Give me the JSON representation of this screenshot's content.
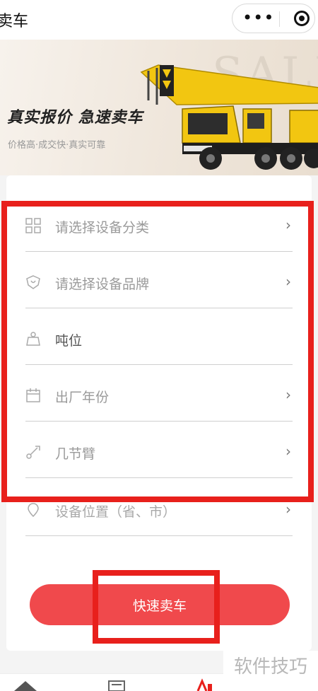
{
  "header": {
    "title": "卖车",
    "more_icon": "ellipsis-icon",
    "close_icon": "target-icon"
  },
  "banner": {
    "bg_text": "SALE",
    "headline": "真实报价  急速卖车",
    "subtitle": "价格高·成交快·真实可靠"
  },
  "form": {
    "rows": [
      {
        "label": "请选择设备分类",
        "icon": "grid-icon",
        "has_arrow": true
      },
      {
        "label": "请选择设备品牌",
        "icon": "shield-heart-icon",
        "has_arrow": true
      },
      {
        "label": "吨位",
        "icon": "weight-icon",
        "has_arrow": false
      },
      {
        "label": "出厂年份",
        "icon": "calendar-icon",
        "has_arrow": true
      },
      {
        "label": "几节臂",
        "icon": "crane-arm-icon",
        "has_arrow": true
      },
      {
        "label": "设备位置（省、市）",
        "icon": "location-icon",
        "has_arrow": true
      }
    ],
    "submit_label": "快速卖车"
  },
  "watermark": "软件技巧",
  "colors": {
    "accent": "#f0494c",
    "highlight": "#e8201c",
    "crane": "#f2c611"
  }
}
